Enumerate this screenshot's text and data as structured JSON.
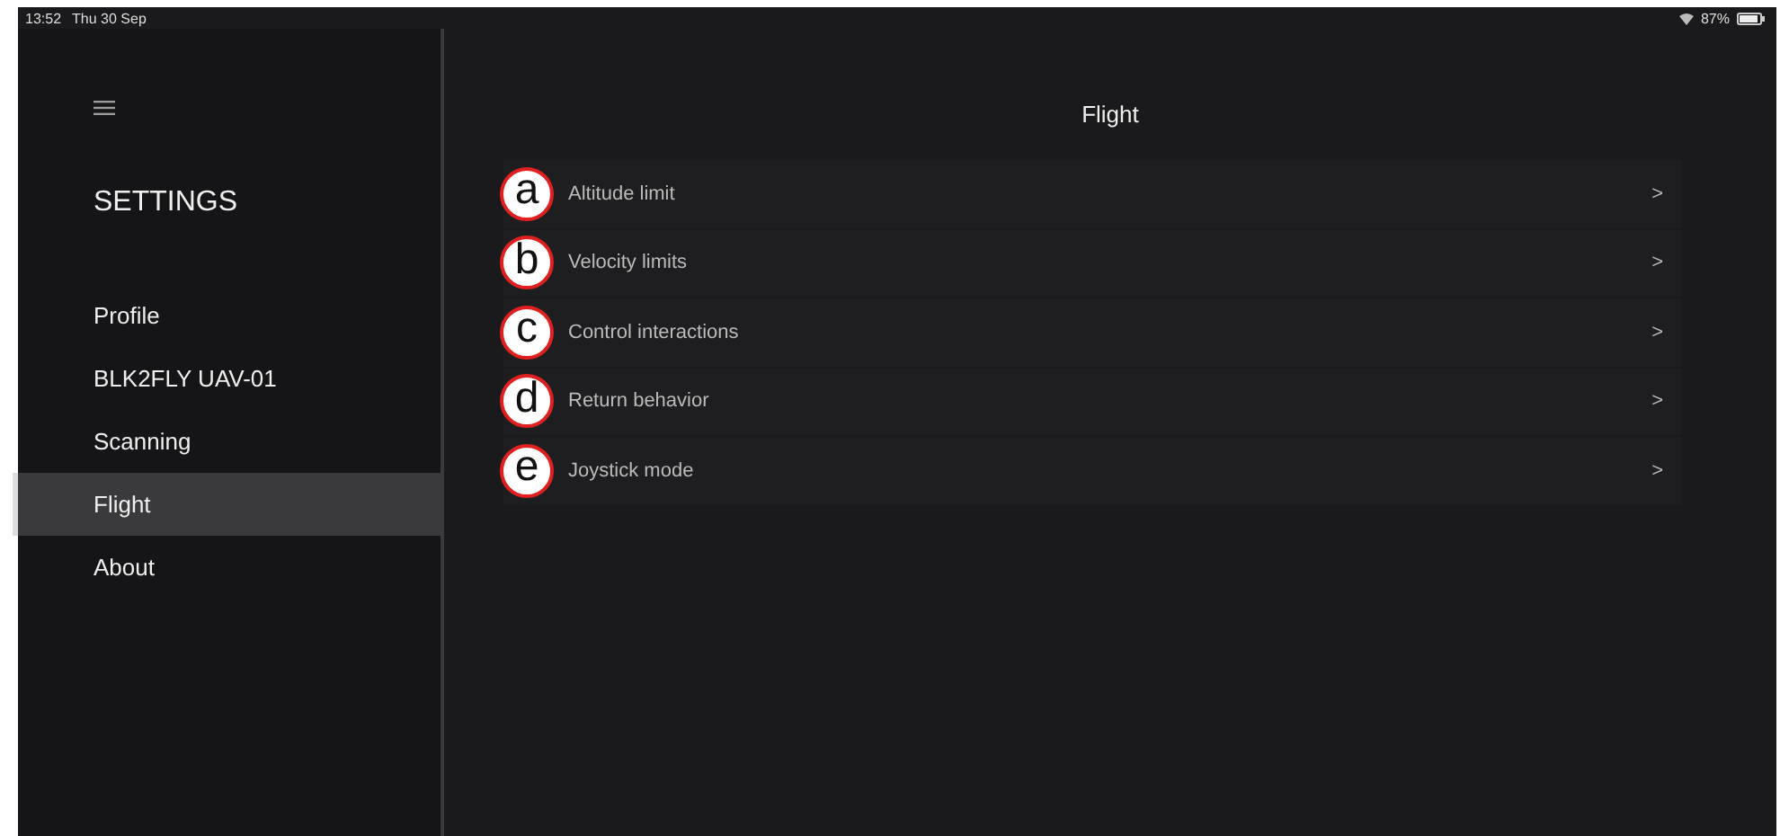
{
  "status_bar": {
    "time": "13:52",
    "date": "Thu 30 Sep",
    "battery": "87%"
  },
  "sidebar": {
    "title": "SETTINGS",
    "items": [
      {
        "label": "Profile",
        "selected": false
      },
      {
        "label": "BLK2FLY UAV-01",
        "selected": false
      },
      {
        "label": "Scanning",
        "selected": false
      },
      {
        "label": "Flight",
        "selected": true
      },
      {
        "label": "About",
        "selected": false
      }
    ]
  },
  "page": {
    "title": "Flight",
    "items": [
      {
        "marker": "a",
        "label": "Altitude limit",
        "chevron": ">"
      },
      {
        "marker": "b",
        "label": "Velocity limits",
        "chevron": ">"
      },
      {
        "marker": "c",
        "label": "Control interactions",
        "chevron": ">"
      },
      {
        "marker": "d",
        "label": "Return behavior",
        "chevron": ">"
      },
      {
        "marker": "e",
        "label": "Joystick mode",
        "chevron": ">"
      }
    ]
  }
}
